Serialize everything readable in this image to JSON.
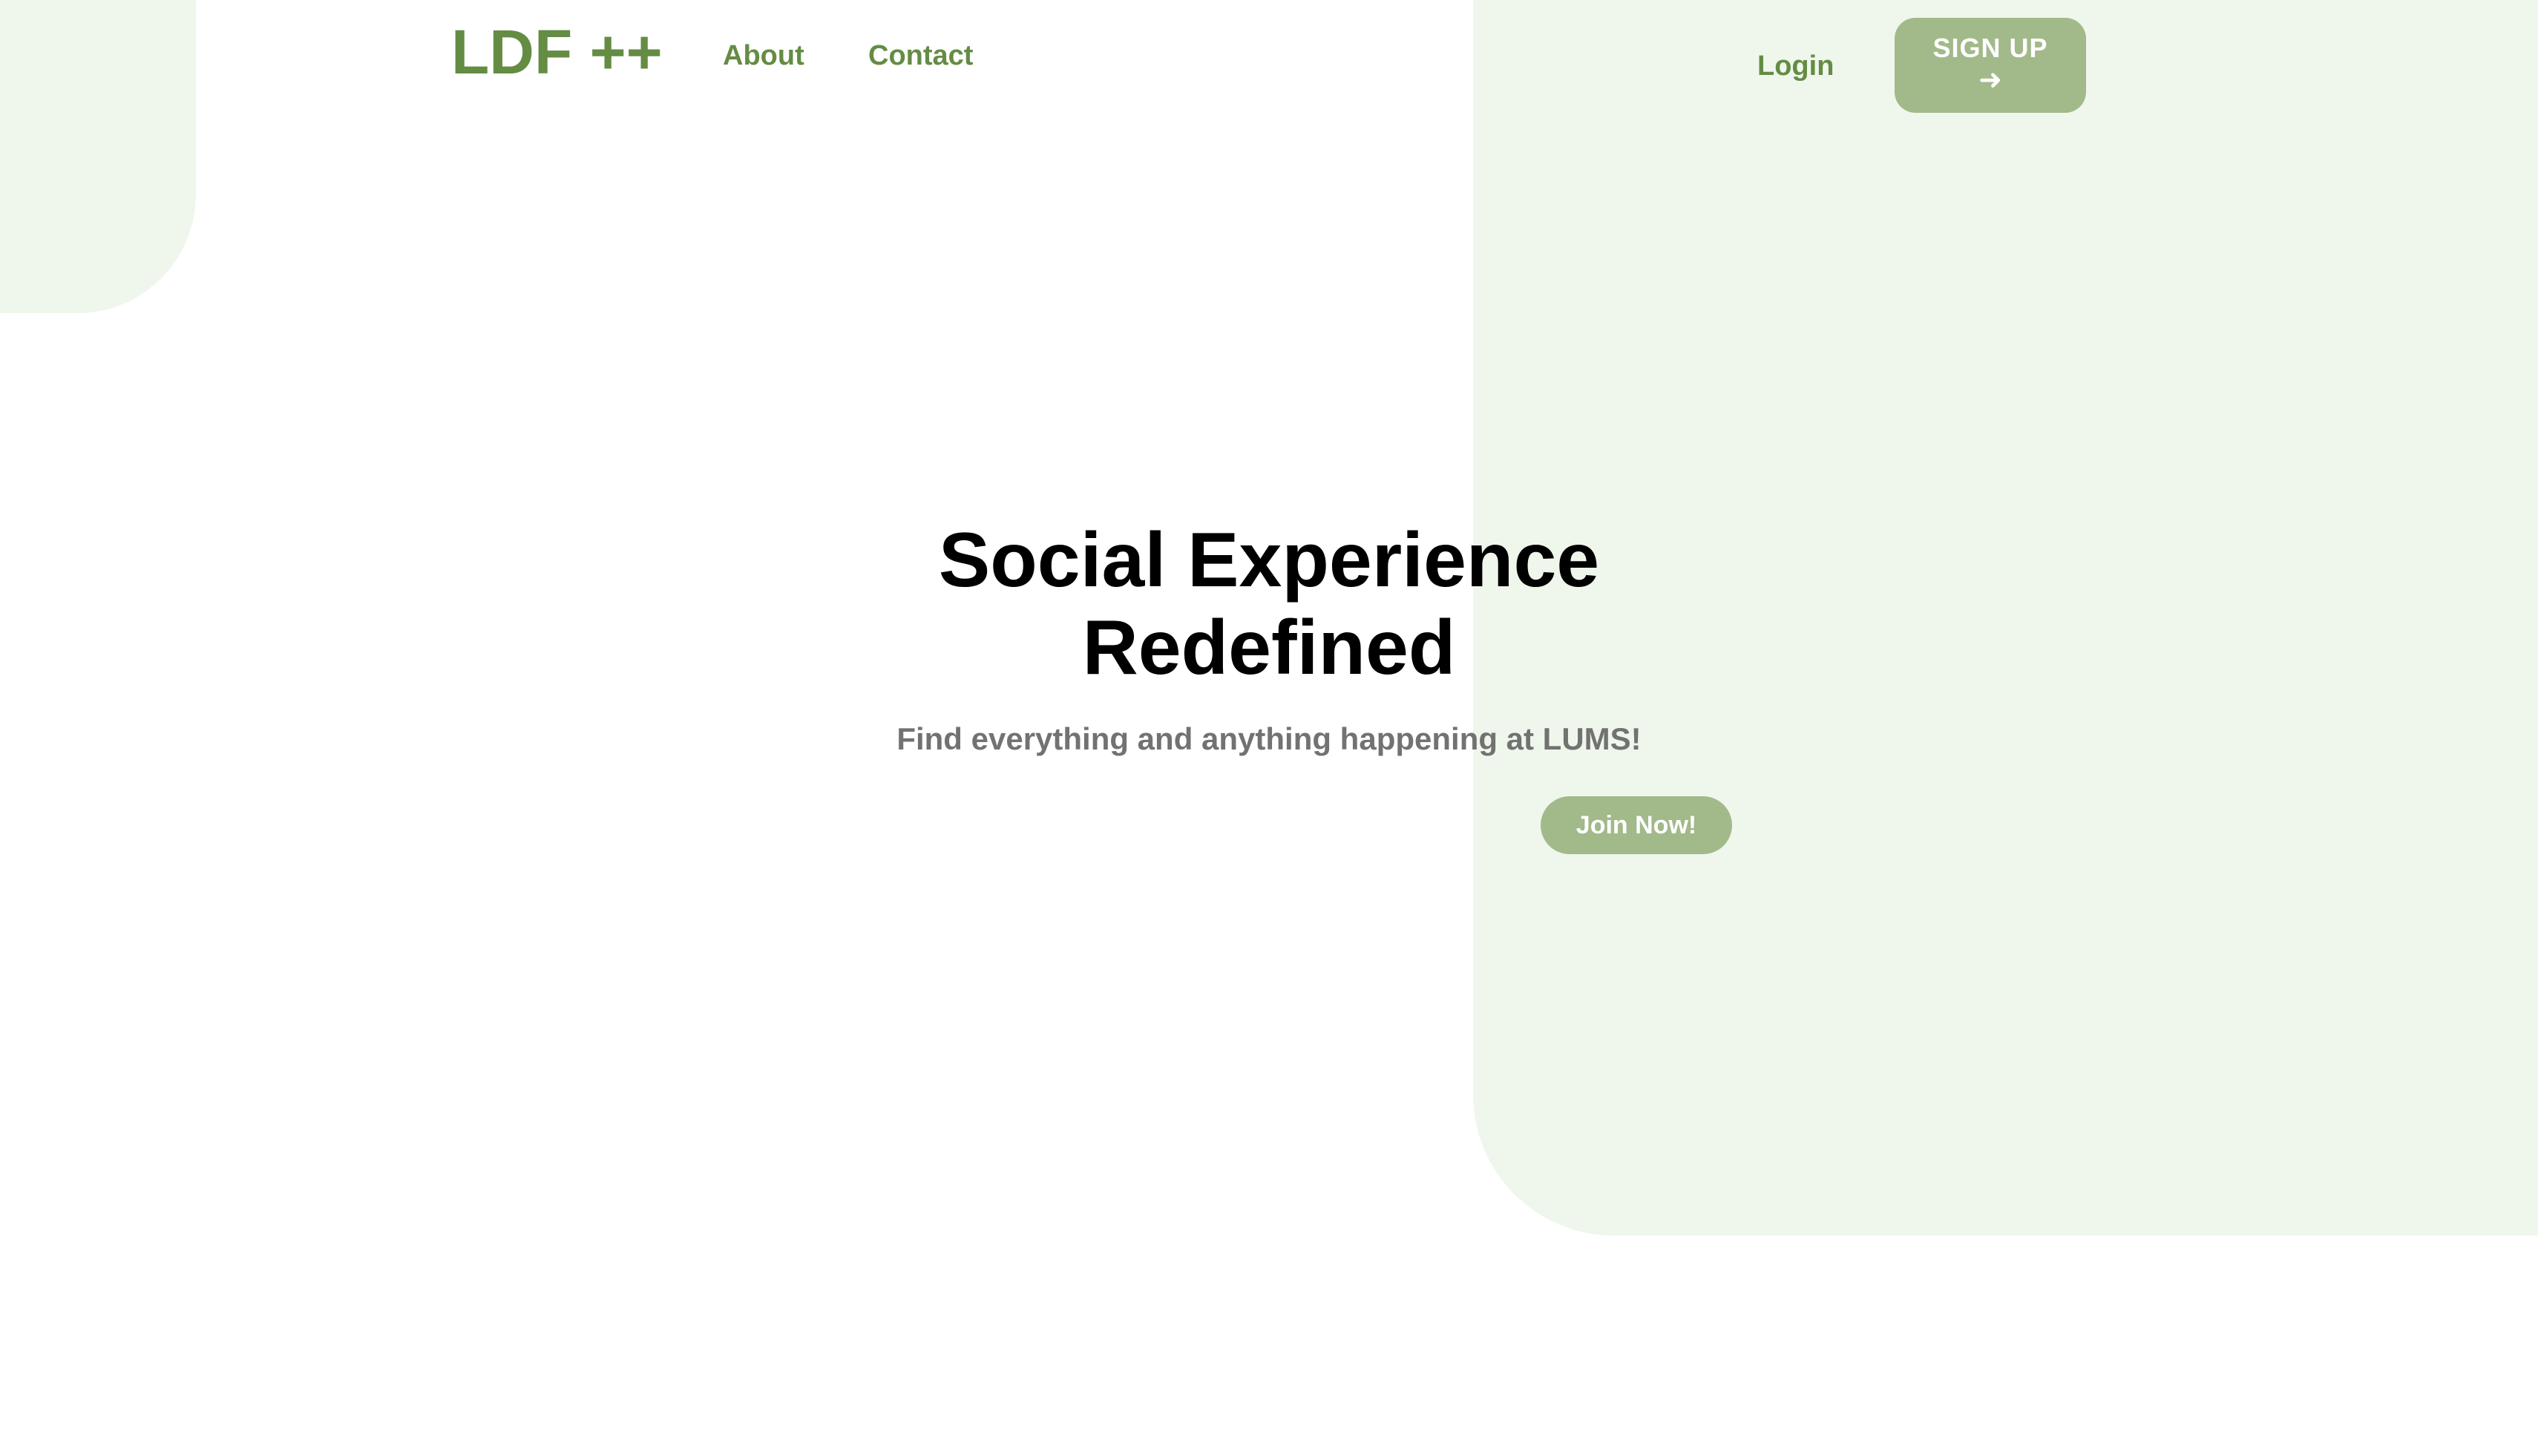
{
  "header": {
    "brand": "LDF ++",
    "nav": {
      "about": "About",
      "contact": "Contact"
    },
    "login": "Login",
    "signup": {
      "label": "SIGN UP",
      "arrow": "➜"
    }
  },
  "hero": {
    "title_line_1": "Social Experience",
    "title_line_2": "Redefined",
    "subtitle": "Find everything and anything happening at LUMS!",
    "cta": "Join Now!"
  },
  "colors": {
    "brand_green": "#648c43",
    "button_green": "#a2b98a",
    "panel_mint": "#eff7ec",
    "heading": "#000000",
    "subtitle": "#727272",
    "background": "#ffffff"
  },
  "icons": {
    "signup_arrow": "right-arrow-icon"
  }
}
